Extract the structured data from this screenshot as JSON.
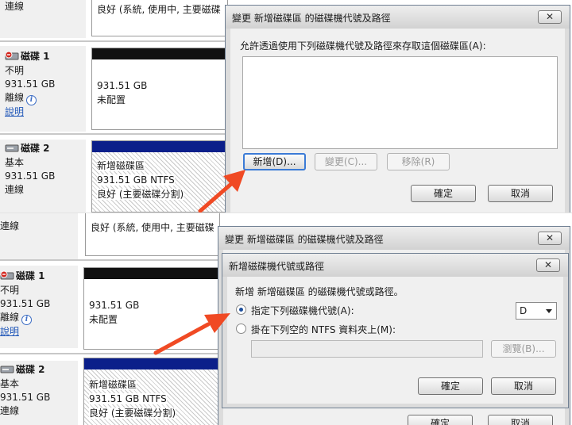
{
  "top": {
    "background": {
      "row0_status": "連線",
      "row0_volume_status": "良好 (系統, 使用中, 主要磁碟",
      "disk1": {
        "name": "磁碟 1",
        "line1": "不明",
        "size": "931.51 GB",
        "state": "離線",
        "help_link": "說明"
      },
      "disk1_volume": {
        "size": "931.51 GB",
        "state": "未配置"
      },
      "disk2": {
        "name": "磁碟 2",
        "line1": "基本",
        "size": "931.51 GB",
        "state": "連線"
      },
      "disk2_volume": {
        "name": "新增磁碟區",
        "size": "931.51 GB NTFS",
        "status": "良好 (主要磁碟分割)"
      }
    },
    "dialog": {
      "title": "變更 新增磁碟區 的磁碟機代號及路徑",
      "close": "✕",
      "description": "允許透過使用下列磁碟機代號及路徑來存取這個磁碟區(A):",
      "buttons": {
        "add": "新增(D)...",
        "change": "變更(C)...",
        "remove": "移除(R)",
        "ok": "確定",
        "cancel": "取消"
      }
    }
  },
  "bottom": {
    "background": {
      "row0_status": "連線",
      "row0_volume_status": "良好 (系統, 使用中, 主要磁碟",
      "disk1": {
        "name": "磁碟 1",
        "line1": "不明",
        "size": "931.51 GB",
        "state": "離線",
        "help_link": "說明"
      },
      "disk1_volume": {
        "size": "931.51 GB",
        "state": "未配置"
      },
      "disk2": {
        "name": "磁碟 2",
        "line1": "基本",
        "size": "931.51 GB",
        "state": "連線"
      },
      "disk2_volume": {
        "name": "新增磁碟區",
        "size": "931.51 GB NTFS",
        "status": "良好 (主要磁碟分割)"
      },
      "behind_buttons": {
        "ok": "確定",
        "cancel": "取消"
      }
    },
    "outer_dialog": {
      "title": "變更 新增磁碟區 的磁碟機代號及路徑",
      "close": "✕"
    },
    "inner_dialog": {
      "title": "新增磁碟機代號或路徑",
      "close": "✕",
      "description": "新增 新增磁碟區 的磁碟機代號或路徑。",
      "option_assign_letter": "指定下列磁碟機代號(A):",
      "drive_letter": "D",
      "option_mount_folder": "掛在下列空的 NTFS 資料夾上(M):",
      "browse": "瀏覽(B)...",
      "ok": "確定",
      "cancel": "取消"
    }
  },
  "colors": {
    "arrow": "#f04a24",
    "titlebar": "#dcdcdc",
    "volume_bar_basic": "#0b1f8a",
    "volume_bar_unallocated": "#111111",
    "link": "#1f56b8"
  },
  "icons": {
    "disk_offline": "disk-offline-icon",
    "disk_online": "disk-icon",
    "info": "info-icon",
    "close": "close-icon",
    "dropdown": "chevron-down-icon"
  }
}
